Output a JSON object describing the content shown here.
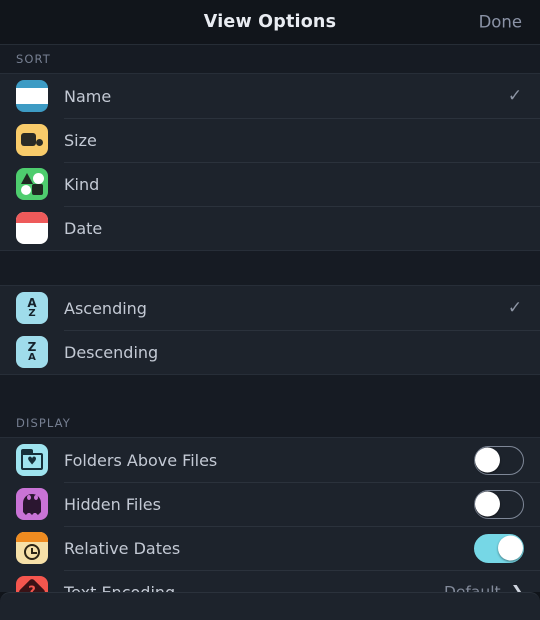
{
  "header": {
    "title": "View Options",
    "done_label": "Done"
  },
  "sections": [
    {
      "title": "SORT",
      "rows": [
        {
          "label": "Name",
          "icon": "name-icon",
          "accessory": "check",
          "checked": true
        },
        {
          "label": "Size",
          "icon": "size-icon",
          "accessory": "none",
          "checked": false
        },
        {
          "label": "Kind",
          "icon": "kind-icon",
          "accessory": "none",
          "checked": false
        },
        {
          "label": "Date",
          "icon": "date-icon",
          "accessory": "none",
          "checked": false
        }
      ]
    },
    {
      "title": "",
      "rows": [
        {
          "label": "Ascending",
          "icon": "sort-ascending-icon",
          "accessory": "check",
          "checked": true
        },
        {
          "label": "Descending",
          "icon": "sort-descending-icon",
          "accessory": "none",
          "checked": false
        }
      ]
    },
    {
      "title": "DISPLAY",
      "rows": [
        {
          "label": "Folders Above Files",
          "icon": "folder-heart-icon",
          "accessory": "toggle",
          "toggle_on": false
        },
        {
          "label": "Hidden Files",
          "icon": "ghost-icon",
          "accessory": "toggle",
          "toggle_on": false
        },
        {
          "label": "Relative Dates",
          "icon": "calendar-clock-icon",
          "accessory": "toggle",
          "toggle_on": true
        },
        {
          "label": "Text Encoding",
          "icon": "encoding-icon",
          "accessory": "disclosure",
          "value": "Default"
        }
      ]
    }
  ],
  "glyphs": {
    "check": "✓",
    "chevron_right": "❯",
    "heart": "♥",
    "question": "?"
  },
  "icon_letters": {
    "ascending_top": "A",
    "ascending_bottom": "Z",
    "descending_top": "Z",
    "descending_bottom": "A"
  },
  "colors": {
    "background": "#10141a",
    "row_background": "#1d232c",
    "accent_on": "#76d7e6",
    "label": "#c3c9d4",
    "section_header": "#767f91"
  }
}
